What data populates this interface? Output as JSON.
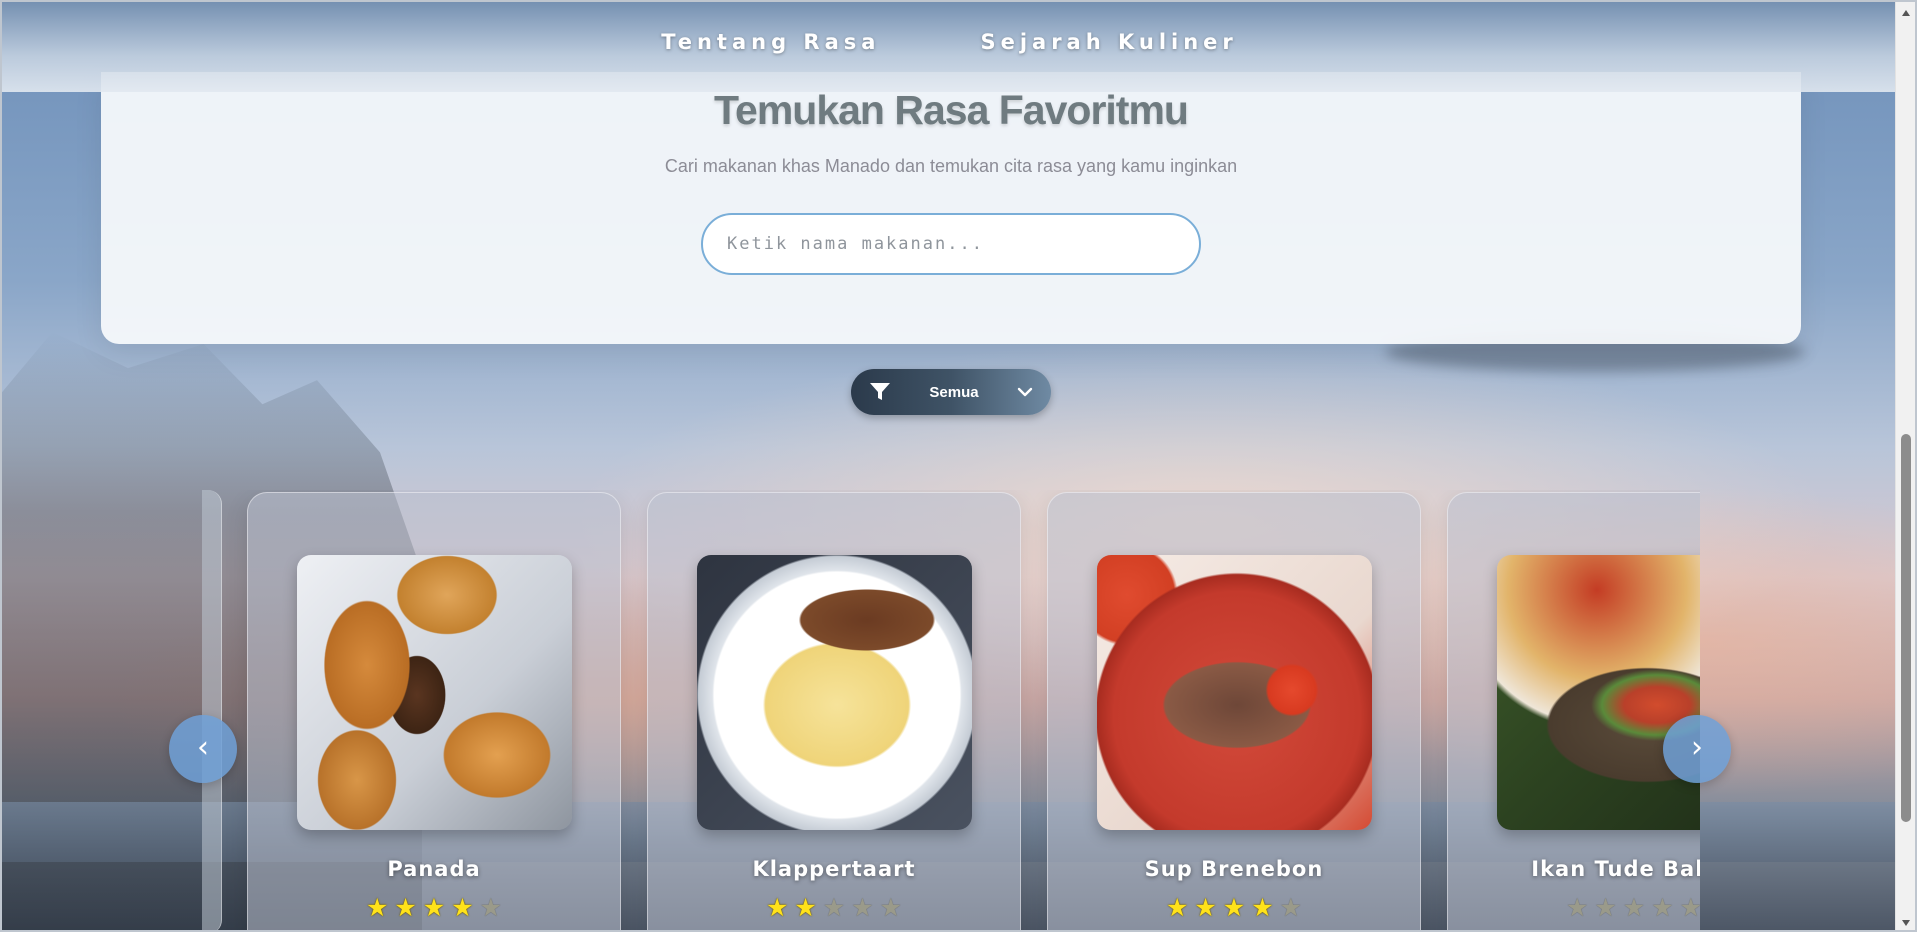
{
  "nav": {
    "links": [
      "Tentang Rasa",
      "Sejarah Kuliner"
    ]
  },
  "hero": {
    "title": "Temukan Rasa Favoritmu",
    "subtitle": "Cari makanan khas Manado dan temukan cita rasa yang kamu inginkan",
    "search_placeholder": "Ketik nama makanan...",
    "search_value": ""
  },
  "filter": {
    "icon": "filter-icon",
    "selected": "Semua",
    "chevron": "chevron-down-icon"
  },
  "carousel": {
    "prev_label": "‹",
    "next_label": "›",
    "cards": [
      {
        "name": "Panada",
        "rating": 4,
        "max_rating": 5
      },
      {
        "name": "Klappertaart",
        "rating": 2,
        "max_rating": 5
      },
      {
        "name": "Sup Brenebon",
        "rating": 4,
        "max_rating": 5
      },
      {
        "name": "Ikan Tude Bakar",
        "rating": 0,
        "max_rating": 5
      }
    ]
  },
  "colors": {
    "accent": "#7aaed8",
    "star_on": "#ffe21a",
    "star_off": "#9a9a8a",
    "filter_dark": "#2b3a4b"
  }
}
